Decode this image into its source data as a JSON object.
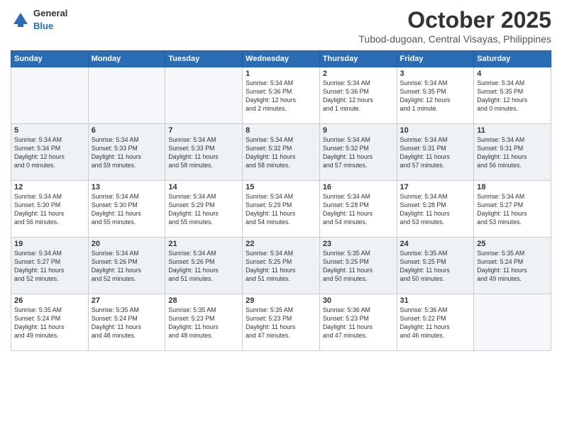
{
  "header": {
    "logo_general": "General",
    "logo_blue": "Blue",
    "title": "October 2025",
    "location": "Tubod-dugoan, Central Visayas, Philippines"
  },
  "days_of_week": [
    "Sunday",
    "Monday",
    "Tuesday",
    "Wednesday",
    "Thursday",
    "Friday",
    "Saturday"
  ],
  "weeks": [
    {
      "days": [
        {
          "num": "",
          "info": ""
        },
        {
          "num": "",
          "info": ""
        },
        {
          "num": "",
          "info": ""
        },
        {
          "num": "1",
          "info": "Sunrise: 5:34 AM\nSunset: 5:36 PM\nDaylight: 12 hours\nand 2 minutes."
        },
        {
          "num": "2",
          "info": "Sunrise: 5:34 AM\nSunset: 5:36 PM\nDaylight: 12 hours\nand 1 minute."
        },
        {
          "num": "3",
          "info": "Sunrise: 5:34 AM\nSunset: 5:35 PM\nDaylight: 12 hours\nand 1 minute."
        },
        {
          "num": "4",
          "info": "Sunrise: 5:34 AM\nSunset: 5:35 PM\nDaylight: 12 hours\nand 0 minutes."
        }
      ]
    },
    {
      "days": [
        {
          "num": "5",
          "info": "Sunrise: 5:34 AM\nSunset: 5:34 PM\nDaylight: 12 hours\nand 0 minutes."
        },
        {
          "num": "6",
          "info": "Sunrise: 5:34 AM\nSunset: 5:33 PM\nDaylight: 11 hours\nand 59 minutes."
        },
        {
          "num": "7",
          "info": "Sunrise: 5:34 AM\nSunset: 5:33 PM\nDaylight: 11 hours\nand 58 minutes."
        },
        {
          "num": "8",
          "info": "Sunrise: 5:34 AM\nSunset: 5:32 PM\nDaylight: 11 hours\nand 58 minutes."
        },
        {
          "num": "9",
          "info": "Sunrise: 5:34 AM\nSunset: 5:32 PM\nDaylight: 11 hours\nand 57 minutes."
        },
        {
          "num": "10",
          "info": "Sunrise: 5:34 AM\nSunset: 5:31 PM\nDaylight: 11 hours\nand 57 minutes."
        },
        {
          "num": "11",
          "info": "Sunrise: 5:34 AM\nSunset: 5:31 PM\nDaylight: 11 hours\nand 56 minutes."
        }
      ]
    },
    {
      "days": [
        {
          "num": "12",
          "info": "Sunrise: 5:34 AM\nSunset: 5:30 PM\nDaylight: 11 hours\nand 56 minutes."
        },
        {
          "num": "13",
          "info": "Sunrise: 5:34 AM\nSunset: 5:30 PM\nDaylight: 11 hours\nand 55 minutes."
        },
        {
          "num": "14",
          "info": "Sunrise: 5:34 AM\nSunset: 5:29 PM\nDaylight: 11 hours\nand 55 minutes."
        },
        {
          "num": "15",
          "info": "Sunrise: 5:34 AM\nSunset: 5:29 PM\nDaylight: 11 hours\nand 54 minutes."
        },
        {
          "num": "16",
          "info": "Sunrise: 5:34 AM\nSunset: 5:28 PM\nDaylight: 11 hours\nand 54 minutes."
        },
        {
          "num": "17",
          "info": "Sunrise: 5:34 AM\nSunset: 5:28 PM\nDaylight: 11 hours\nand 53 minutes."
        },
        {
          "num": "18",
          "info": "Sunrise: 5:34 AM\nSunset: 5:27 PM\nDaylight: 11 hours\nand 53 minutes."
        }
      ]
    },
    {
      "days": [
        {
          "num": "19",
          "info": "Sunrise: 5:34 AM\nSunset: 5:27 PM\nDaylight: 11 hours\nand 52 minutes."
        },
        {
          "num": "20",
          "info": "Sunrise: 5:34 AM\nSunset: 5:26 PM\nDaylight: 11 hours\nand 52 minutes."
        },
        {
          "num": "21",
          "info": "Sunrise: 5:34 AM\nSunset: 5:26 PM\nDaylight: 11 hours\nand 51 minutes."
        },
        {
          "num": "22",
          "info": "Sunrise: 5:34 AM\nSunset: 5:25 PM\nDaylight: 11 hours\nand 51 minutes."
        },
        {
          "num": "23",
          "info": "Sunrise: 5:35 AM\nSunset: 5:25 PM\nDaylight: 11 hours\nand 50 minutes."
        },
        {
          "num": "24",
          "info": "Sunrise: 5:35 AM\nSunset: 5:25 PM\nDaylight: 11 hours\nand 50 minutes."
        },
        {
          "num": "25",
          "info": "Sunrise: 5:35 AM\nSunset: 5:24 PM\nDaylight: 11 hours\nand 49 minutes."
        }
      ]
    },
    {
      "days": [
        {
          "num": "26",
          "info": "Sunrise: 5:35 AM\nSunset: 5:24 PM\nDaylight: 11 hours\nand 49 minutes."
        },
        {
          "num": "27",
          "info": "Sunrise: 5:35 AM\nSunset: 5:24 PM\nDaylight: 11 hours\nand 48 minutes."
        },
        {
          "num": "28",
          "info": "Sunrise: 5:35 AM\nSunset: 5:23 PM\nDaylight: 11 hours\nand 48 minutes."
        },
        {
          "num": "29",
          "info": "Sunrise: 5:35 AM\nSunset: 5:23 PM\nDaylight: 11 hours\nand 47 minutes."
        },
        {
          "num": "30",
          "info": "Sunrise: 5:36 AM\nSunset: 5:23 PM\nDaylight: 11 hours\nand 47 minutes."
        },
        {
          "num": "31",
          "info": "Sunrise: 5:36 AM\nSunset: 5:22 PM\nDaylight: 11 hours\nand 46 minutes."
        },
        {
          "num": "",
          "info": ""
        }
      ]
    }
  ]
}
